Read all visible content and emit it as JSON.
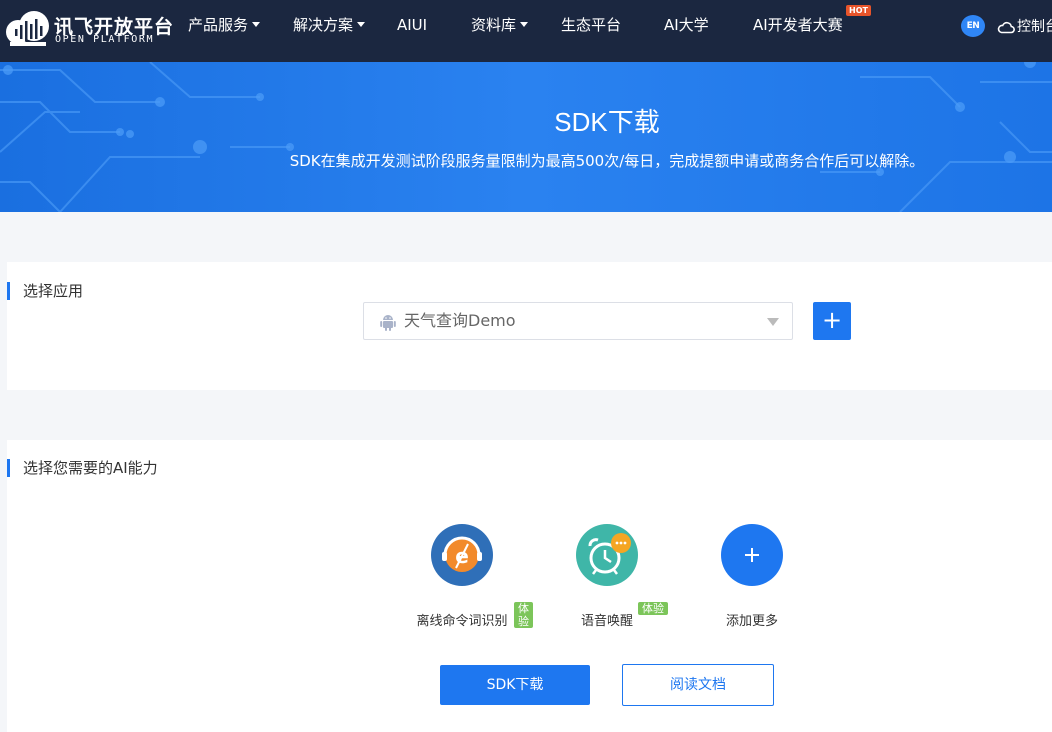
{
  "nav": {
    "logo_title": "讯飞开放平台",
    "logo_subtitle": "OPEN PLATFORM",
    "items": [
      {
        "label": "产品服务",
        "has_dropdown": true
      },
      {
        "label": "解决方案",
        "has_dropdown": true
      },
      {
        "label": "AIUI",
        "has_dropdown": false
      },
      {
        "label": "资料库",
        "has_dropdown": true
      },
      {
        "label": "生态平台",
        "has_dropdown": false
      },
      {
        "label": "AI大学",
        "has_dropdown": false
      },
      {
        "label": "AI开发者大赛",
        "has_dropdown": false
      }
    ],
    "hot_badge": "HOT",
    "lang_button": "EN",
    "console_label": "控制台",
    "console_icon": "cloud-icon"
  },
  "banner": {
    "title": "SDK下载",
    "subtitle": "SDK在集成开发测试阶段服务量限制为最高500次/每日，完成提额申请或商务合作后可以解除。"
  },
  "select_app": {
    "section_title": "选择应用",
    "selected_value": "天气查询Demo",
    "platform_icon": "android-icon",
    "add_button_label": "+"
  },
  "abilities": {
    "section_title": "选择您需要的AI能力",
    "items": [
      {
        "label": "离线命令词识别",
        "badge": "体验",
        "icon": "offline-command-icon",
        "color": "#2f6fb8"
      },
      {
        "label": "语音唤醒",
        "badge": "体验",
        "icon": "alarm-clock-icon",
        "color": "#3fb6a8"
      },
      {
        "label": "添加更多",
        "badge": "",
        "icon": "add-icon",
        "color": "#1e77f0"
      }
    ]
  },
  "actions": {
    "download_label": "SDK下载",
    "docs_label": "阅读文档"
  },
  "colors": {
    "nav_bg": "#1b2740",
    "primary": "#1e77f0",
    "badge": "#7cc55a",
    "hot": "#e8542a"
  }
}
